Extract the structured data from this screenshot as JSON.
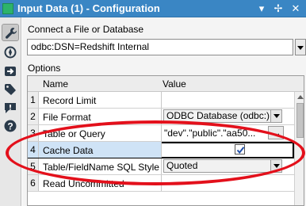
{
  "window": {
    "title": "Input Data (1) - Configuration",
    "buttons": {
      "dropdown": "▾",
      "pin": "✢",
      "close": "✕"
    }
  },
  "toolbar": {
    "items": [
      {
        "icon": "wrench-icon",
        "active": true
      },
      {
        "icon": "compass-icon",
        "active": false
      },
      {
        "icon": "arrow-right-icon",
        "active": false
      },
      {
        "icon": "tag-icon",
        "active": false
      },
      {
        "icon": "comment-icon",
        "active": false
      },
      {
        "icon": "help-icon",
        "active": false
      }
    ]
  },
  "connect": {
    "label": "Connect a File or Database",
    "value": "odbc:DSN=Redshift Internal"
  },
  "options": {
    "label": "Options",
    "columns": {
      "name": "Name",
      "value": "Value"
    },
    "rows": [
      {
        "num": "1",
        "name": "Record Limit",
        "value": ""
      },
      {
        "num": "2",
        "name": "File Format",
        "value": "ODBC Database (odbc:)"
      },
      {
        "num": "3",
        "name": "Table or Query",
        "value": "\"dev\".\"public\".\"aa50...",
        "button": "..."
      },
      {
        "num": "4",
        "name": "Cache Data",
        "checked": true
      },
      {
        "num": "5",
        "name": "Table/FieldName SQL Style",
        "value": "Quoted"
      },
      {
        "num": "6",
        "name": "Read Uncommitted",
        "value": ""
      }
    ]
  },
  "colors": {
    "title_bar": "#3a86c4",
    "annotation": "#e3101b",
    "checkmark": "#1f4ea8"
  }
}
